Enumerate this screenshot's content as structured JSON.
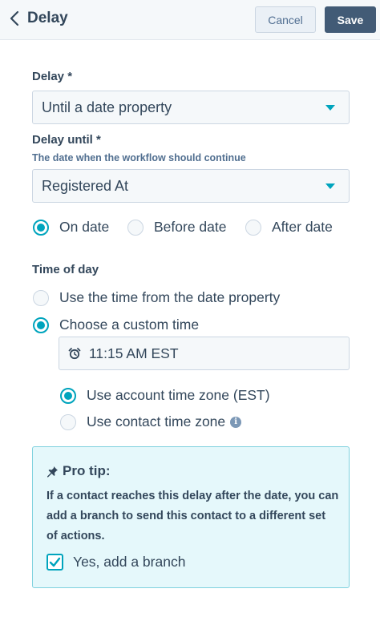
{
  "header": {
    "title": "Delay",
    "cancel_label": "Cancel",
    "save_label": "Save"
  },
  "delay": {
    "label": "Delay *",
    "selected": "Until a date property"
  },
  "delay_until": {
    "label": "Delay until *",
    "help": "The date when the workflow should continue",
    "selected": "Registered At"
  },
  "date_options": [
    {
      "label": "On date",
      "selected": true
    },
    {
      "label": "Before date",
      "selected": false
    },
    {
      "label": "After date",
      "selected": false
    }
  ],
  "time_of_day": {
    "label": "Time of day",
    "options": [
      {
        "label": "Use the time from the date property",
        "selected": false
      },
      {
        "label": "Choose a custom time",
        "selected": true
      }
    ],
    "time_value": "11:15 AM EST",
    "timezone_options": [
      {
        "label": "Use account time zone (EST)",
        "selected": true
      },
      {
        "label": "Use contact time zone",
        "selected": false
      }
    ]
  },
  "pro_tip": {
    "title": "Pro tip:",
    "body": "If a contact reaches this delay after the date, you can add a branch to send this contact to a different set of actions.",
    "checkbox_label": "Yes, add a branch",
    "checked": true
  },
  "colors": {
    "accent": "#00a4bd",
    "primary_button": "#425b76",
    "text": "#33475b",
    "tip_bg": "#e5f8fb"
  },
  "icons": [
    "chevron-left-icon",
    "caret-down-icon",
    "alarm-clock-icon",
    "info-icon",
    "pushpin-icon",
    "checkmark-icon"
  ]
}
